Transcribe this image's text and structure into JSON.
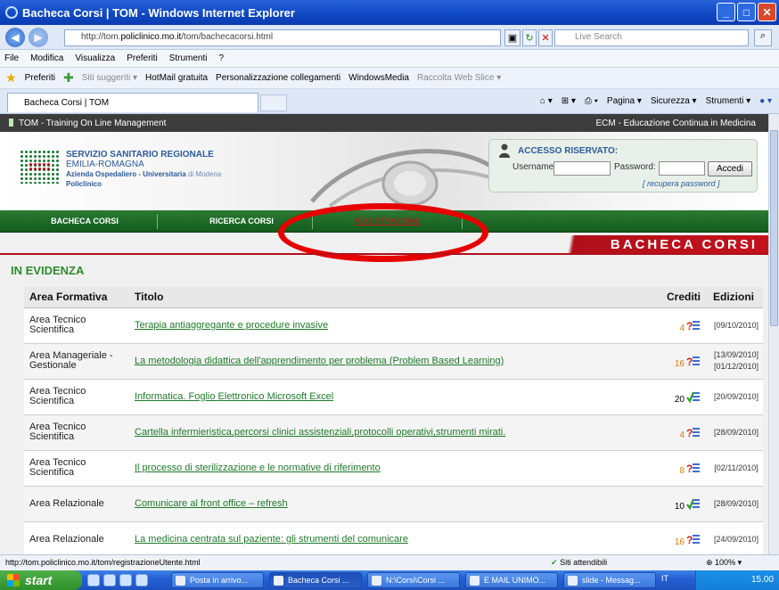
{
  "window": {
    "title": "Bacheca Corsi | TOM - Windows Internet Explorer"
  },
  "address": {
    "url_prefix": "http://tom.",
    "url_domain": "policlinico.mo.it",
    "url_rest": "/tom/bachecacorsi.html"
  },
  "search": {
    "placeholder": "Live Search"
  },
  "menu": [
    "File",
    "Modifica",
    "Visualizza",
    "Preferiti",
    "Strumenti",
    "?"
  ],
  "favorites": {
    "label": "Preferiti",
    "items": [
      "Siti suggeriti ▾",
      "HotMail gratuita",
      "Personalizzazione collegamenti",
      "WindowsMedia",
      "Raccolta Web Slice ▾"
    ]
  },
  "tab": {
    "title": "Bacheca Corsi | TOM"
  },
  "toolbar": {
    "pagina": "Pagina ▾",
    "sicurezza": "Sicurezza ▾",
    "strumenti": "Strumenti ▾"
  },
  "site": {
    "strip_left": "TOM - Training On Line Management",
    "strip_right": "ECM - Educazione Continua in Medicina",
    "ssr": {
      "line1": "SERVIZIO SANITARIO REGIONALE",
      "line2": "EMILIA-ROMAGNA",
      "line3": "Azienda Ospedaliero - Universitaria",
      "line3b": "di Modena",
      "line4": "Policlinico"
    },
    "login": {
      "title": "ACCESSO RISERVATO:",
      "username": "Username:",
      "password": "Password:",
      "button": "Accedi",
      "recover": "[ recupera password ]"
    },
    "nav": {
      "bacheca": "BACHECA CORSI",
      "ricerca": "RICERCA CORSI",
      "registrazione": "REGISTRAZIONE"
    },
    "banner": "BACHECA CORSI",
    "section": "IN EVIDENZA",
    "table": {
      "headers": {
        "area": "Area Formativa",
        "titolo": "Titolo",
        "crediti": "Crediti",
        "edizioni": "Edizioni"
      },
      "rows": [
        {
          "area": "Area Tecnico Scientifica",
          "titolo": "Terapia antiaggregante e procedure invasive",
          "crediti": "4",
          "edizioni": "[09/10/2010]"
        },
        {
          "area": "Area Manageriale - Gestionale",
          "titolo": "La metodologia didattica dell'apprendimento per problema (Problem Based Learning)",
          "crediti": "16",
          "edizioni": "[13/09/2010] [01/12/2010]"
        },
        {
          "area": "Area Tecnico Scientifica",
          "titolo": "Informatica. Foglio Elettronico Microsoft Excel",
          "crediti": "20",
          "edizioni": "[20/09/2010]"
        },
        {
          "area": "Area Tecnico Scientifica",
          "titolo": "Cartella infermieristica,percorsi clinici assistenziali,protocolli operativi,strumenti mirati.",
          "crediti": "4",
          "edizioni": "[28/09/2010]"
        },
        {
          "area": "Area Tecnico Scientifica",
          "titolo": "Il processo di sterilizzazione e le normative di riferimento",
          "crediti": "8",
          "edizioni": "[02/11/2010]"
        },
        {
          "area": "Area Relazionale",
          "titolo": "Comunicare al front office – refresh",
          "crediti": "10",
          "edizioni": "[28/09/2010]"
        },
        {
          "area": "Area Relazionale",
          "titolo": "La medicina centrata sul paziente: gli strumenti del comunicare",
          "crediti": "16",
          "edizioni": "[24/09/2010]"
        }
      ]
    }
  },
  "status": {
    "url": "http://tom.policlinico.mo.it/tom/registrazioneUtente.html",
    "zone": "Siti attendibili",
    "zoom": "100%"
  },
  "taskbar": {
    "start": "start",
    "tasks": [
      "Posta in arrivo...",
      "Bacheca Corsi ...",
      "N:\\Corsi\\Corsi ...",
      "E MAIL UNIMO...",
      "slide - Messag..."
    ],
    "lang": "IT",
    "clock": "15.00"
  },
  "colors": {
    "nav_green": "#145c1d",
    "banner_red": "#b0101a",
    "section_green": "#2e8b2e",
    "annotation_red": "#e60000"
  }
}
